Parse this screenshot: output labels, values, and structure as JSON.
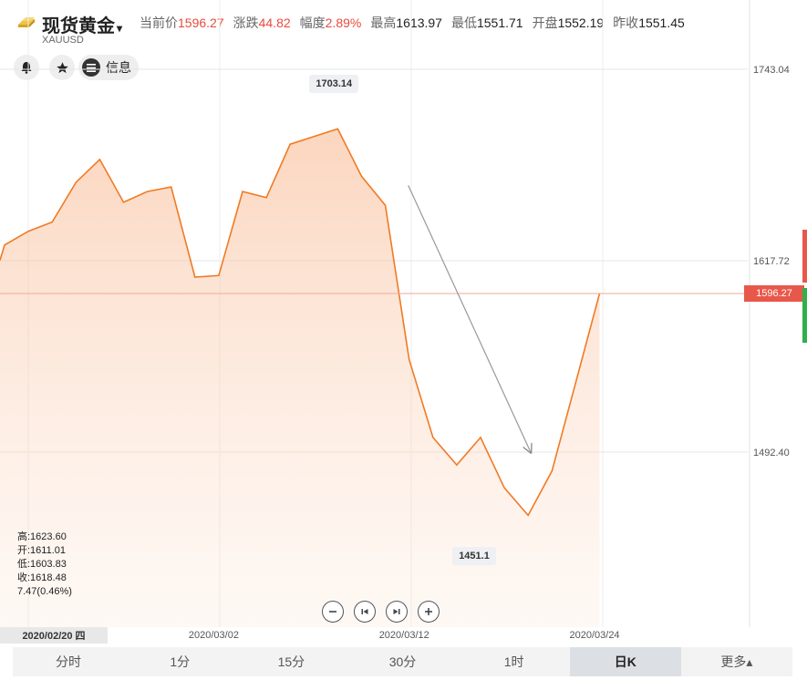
{
  "header": {
    "title": "现货黄金",
    "caret": "▾",
    "symbol": "XAUUSD",
    "stats": [
      {
        "label": "当前价",
        "value": "1596.27",
        "up": true
      },
      {
        "label": "涨跌",
        "value": "44.82",
        "up": true
      },
      {
        "label": "幅度",
        "value": "2.89%",
        "up": true
      },
      {
        "label": "最高",
        "value": "1613.97",
        "up": false
      },
      {
        "label": "最低",
        "value": "1551.71",
        "up": false
      },
      {
        "label": "开盘",
        "value": "1552.19",
        "up": false
      },
      {
        "label": "昨收",
        "value": "1551.45",
        "up": false
      }
    ]
  },
  "actions": {
    "info_label": "信息"
  },
  "colors": {
    "line": "#f07a24",
    "up": "#e84b3c",
    "down": "#2fb04a",
    "tag": "#e8584a"
  },
  "chart_data": {
    "type": "area",
    "y_ticks": [
      "1743.04",
      "1617.72",
      "1492.40"
    ],
    "ylim": [
      1403.0,
      1783.0
    ],
    "values": [
      1628,
      1637,
      1643,
      1669,
      1684,
      1656,
      1663,
      1666,
      1607,
      1608,
      1663,
      1659,
      1694,
      1699,
      1704,
      1673,
      1654,
      1553,
      1502,
      1484,
      1502,
      1469,
      1451,
      1480,
      1538,
      1596.27
    ],
    "x_labels": [
      {
        "text": "2020/02/20 四",
        "index": 1
      },
      {
        "text": "2020/03/02",
        "index": 9
      },
      {
        "text": "2020/03/12",
        "index": 17
      },
      {
        "text": "2020/03/24",
        "index": 25
      }
    ],
    "current_price": "1596.27",
    "max_label": "1703.14",
    "min_label": "1451.1",
    "max_index": 14,
    "min_index": 22,
    "arrow": {
      "from_index": 17,
      "from_value": 1667,
      "to_index": 22,
      "to_value": 1492
    }
  },
  "ohlc": {
    "high": "高:1623.60",
    "open": "开:1611.01",
    "low": "低:1603.83",
    "close": "收:1618.48",
    "change": "7.47(0.46%)"
  },
  "controls": [
    "zoom-out",
    "step-back",
    "step-forward",
    "zoom-in"
  ],
  "tabs": [
    {
      "label": "分时",
      "active": false
    },
    {
      "label": "1分",
      "active": false
    },
    {
      "label": "15分",
      "active": false
    },
    {
      "label": "30分",
      "active": false
    },
    {
      "label": "1时",
      "active": false
    },
    {
      "label": "日K",
      "active": true
    },
    {
      "label": "更多▴",
      "active": false
    }
  ]
}
